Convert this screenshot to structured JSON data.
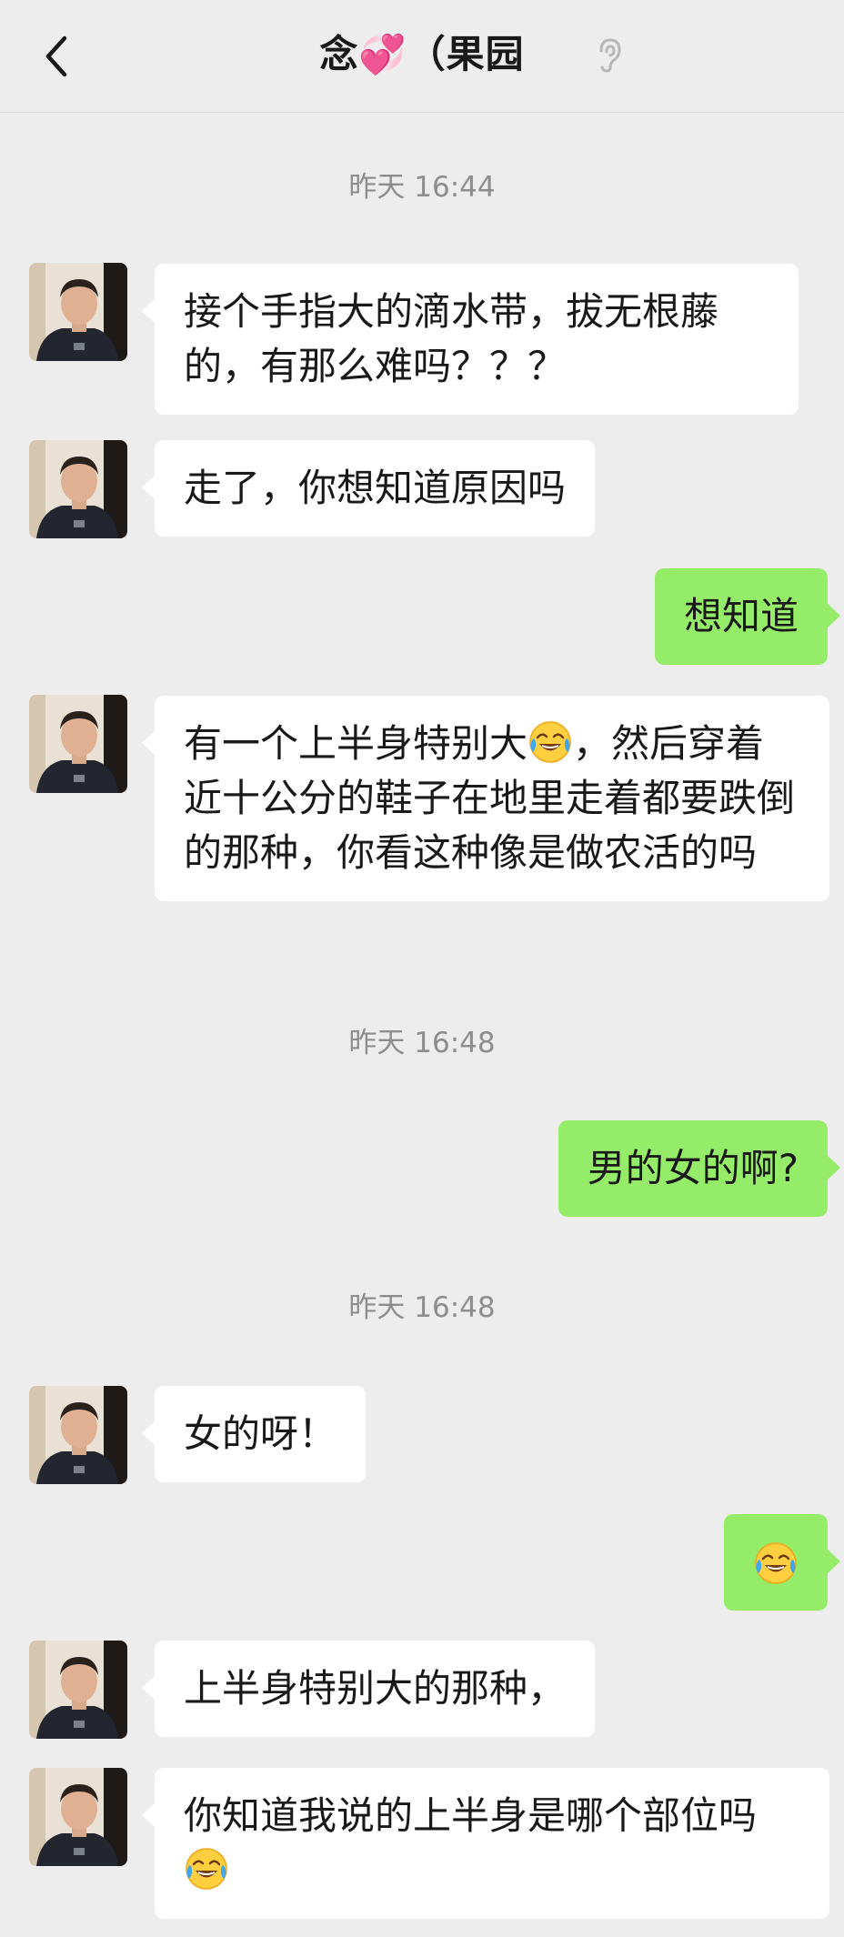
{
  "header": {
    "title": "念💞（果园",
    "back_icon": "back-arrow-icon",
    "ear_icon": "earpiece-mode-icon"
  },
  "timestamps": [
    "昨天 16:44",
    "昨天 16:48",
    "昨天 16:48"
  ],
  "messages": [
    {
      "side": "left",
      "text": "接个手指大的滴水带，拔无根藤的，有那么难吗？？？"
    },
    {
      "side": "left",
      "text": "走了，你想知道原因吗"
    },
    {
      "side": "right",
      "text": "想知道"
    },
    {
      "side": "left",
      "text_before": "有一个上半身特别大",
      "emoji": "laughing-crying-face",
      "text_after": "，然后穿着近十公分的鞋子在地里走着都要跌倒的那种，你看这种像是做农活的吗"
    },
    {
      "side": "right",
      "text": "男的女的啊?"
    },
    {
      "side": "left",
      "text": "女的呀！"
    },
    {
      "side": "right",
      "emoji": "laughing-crying-face"
    },
    {
      "side": "left",
      "text": "上半身特别大的那种，"
    },
    {
      "side": "left",
      "text": "你知道我说的上半身是哪个部位吗",
      "emoji": "laughing-crying-face"
    }
  ],
  "colors": {
    "background": "#ededed",
    "bubble_left": "#ffffff",
    "bubble_right": "#95ec69",
    "timestamp": "#8d8d8d"
  }
}
